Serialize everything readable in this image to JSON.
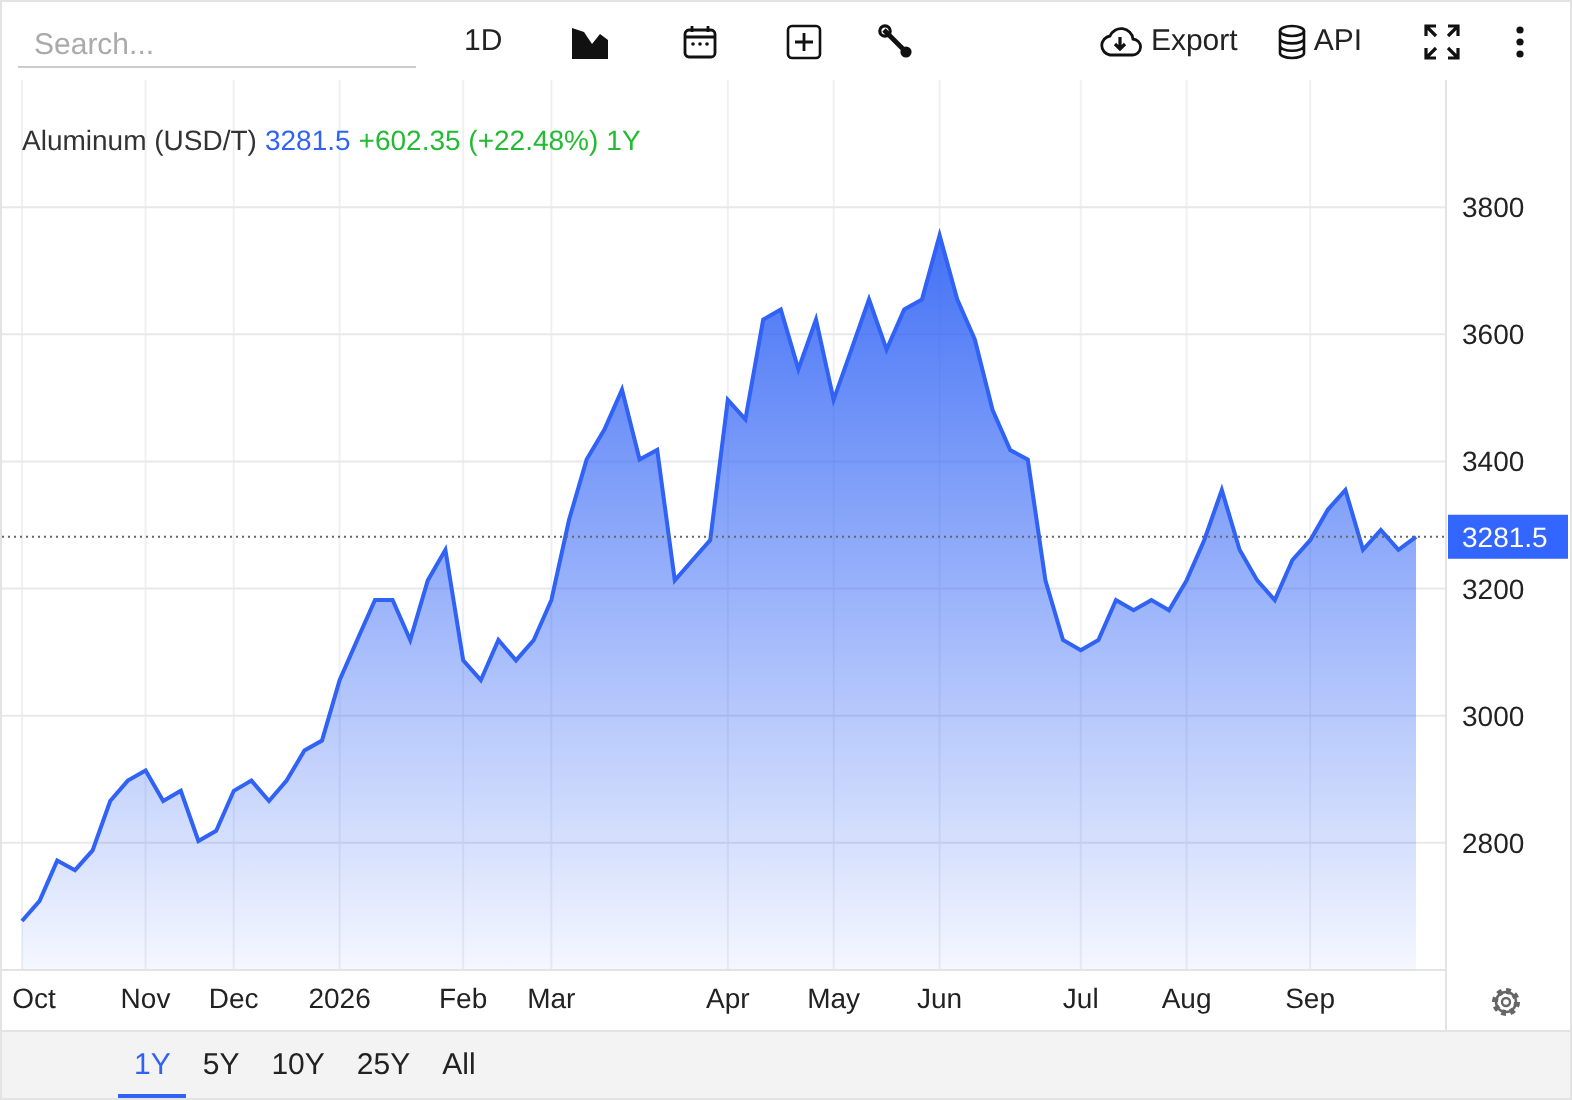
{
  "toolbar": {
    "search": {
      "placeholder": "Search..."
    },
    "interval": "1D",
    "export": "Export",
    "api": "API"
  },
  "chart": {
    "legend": {
      "price": "3281.5",
      "change": "+602.35 (+22.48%)",
      "period": "1Y"
    },
    "chart_data": {
      "type": "area",
      "grid": true,
      "ylim": [
        2600,
        4000
      ],
      "yticks": [
        2800,
        3000,
        3200,
        3400,
        3600,
        3800
      ],
      "categories": [
        "Oct",
        null,
        null,
        null,
        null,
        null,
        null,
        "Nov",
        null,
        null,
        null,
        null,
        "Dec",
        null,
        null,
        null,
        null,
        null,
        "2026",
        null,
        null,
        null,
        null,
        null,
        null,
        "Feb",
        null,
        null,
        null,
        null,
        "Mar",
        null,
        null,
        null,
        null,
        null,
        null,
        null,
        null,
        null,
        "Apr",
        null,
        null,
        null,
        null,
        null,
        "May",
        null,
        null,
        null,
        null,
        null,
        "Jun",
        null,
        null,
        null,
        null,
        null,
        null,
        null,
        "Jul",
        null,
        null,
        null,
        null,
        null,
        "Aug",
        null,
        null,
        null,
        null,
        null,
        null,
        "Sep",
        null,
        null,
        null,
        null,
        null,
        null
      ],
      "series": [
        {
          "name": "Aluminum (USD/T)",
          "color": "#2f62f5",
          "values": [
            2677,
            2709,
            2772,
            2757,
            2788,
            2866,
            2898,
            2914,
            2866,
            2882,
            2803,
            2819,
            2882,
            2898,
            2866,
            2898,
            2945,
            2961,
            3056,
            3119,
            3182,
            3182,
            3119,
            3213,
            3261,
            3087,
            3056,
            3119,
            3087,
            3119,
            3182,
            3308,
            3403,
            3450,
            3513,
            3403,
            3418,
            3213,
            3245,
            3276,
            3497,
            3466,
            3623,
            3639,
            3545,
            3623,
            3497,
            3576,
            3655,
            3576,
            3639,
            3655,
            3756,
            3655,
            3592,
            3481,
            3418,
            3403,
            3213,
            3119,
            3103,
            3119,
            3182,
            3166,
            3182,
            3166,
            3213,
            3276,
            3355,
            3261,
            3213,
            3182,
            3245,
            3276,
            3324,
            3355,
            3261,
            3292,
            3261,
            3281.5
          ]
        }
      ],
      "ref_lines": [
        {
          "axis": "y",
          "value": 3281.5,
          "label": "3281.5"
        }
      ]
    }
  },
  "ranges": [
    {
      "label": "1Y",
      "selected": true
    },
    {
      "label": "5Y",
      "selected": false
    },
    {
      "label": "10Y",
      "selected": false
    },
    {
      "label": "25Y",
      "selected": false
    },
    {
      "label": "All",
      "selected": false
    }
  ]
}
